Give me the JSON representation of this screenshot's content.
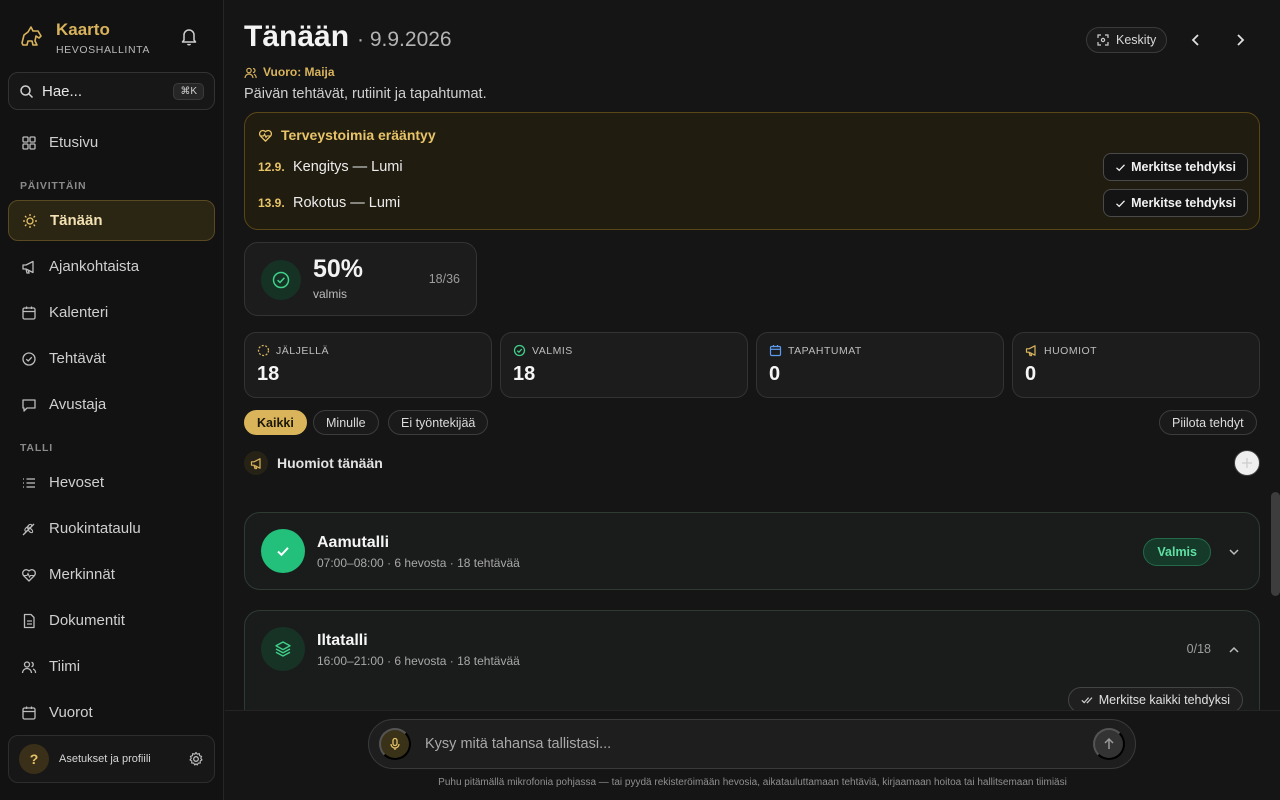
{
  "brand": {
    "name": "Kaarto",
    "subtitle": "HEVOSHALLINTA"
  },
  "search": {
    "placeholder": "Hae...",
    "shortcut": "⌘K"
  },
  "nav": {
    "top": [
      {
        "label": "Etusivu",
        "icon": "grid-icon"
      }
    ],
    "section_daily": "PÄIVITTÄIN",
    "daily": [
      {
        "label": "Tänään",
        "icon": "sun-icon",
        "active": true
      },
      {
        "label": "Ajankohtaista",
        "icon": "megaphone-icon"
      },
      {
        "label": "Kalenteri",
        "icon": "calendar-icon"
      },
      {
        "label": "Tehtävät",
        "icon": "check-circle-icon"
      },
      {
        "label": "Avustaja",
        "icon": "chat-icon"
      }
    ],
    "section_stable": "TALLI",
    "stable": [
      {
        "label": "Hevoset",
        "icon": "list-icon"
      },
      {
        "label": "Ruokintataulu",
        "icon": "wheat-icon"
      },
      {
        "label": "Merkinnät",
        "icon": "heart-pulse-icon"
      },
      {
        "label": "Dokumentit",
        "icon": "document-icon"
      },
      {
        "label": "Tiimi",
        "icon": "users-icon"
      },
      {
        "label": "Vuorot",
        "icon": "calendar-icon"
      }
    ]
  },
  "profile": {
    "avatar": "?",
    "label": "Asetukset ja profiili"
  },
  "header": {
    "title": "Tänään",
    "date": "· 9.9.2026",
    "shift": "Vuoro: Maija",
    "subtitle": "Päivän tehtävät, rutiinit ja tapahtumat.",
    "focus_label": "Keskity"
  },
  "health_alert": {
    "title": "Terveystoimia erääntyy",
    "items": [
      {
        "date": "12.9.",
        "text": "Kengitys — Lumi",
        "action": "Merkitse tehdyksi"
      },
      {
        "date": "13.9.",
        "text": "Rokotus — Lumi",
        "action": "Merkitse tehdyksi"
      }
    ]
  },
  "progress": {
    "percent_label": "50%",
    "label": "valmis",
    "count": "18/36",
    "fraction": 0.5
  },
  "stats": [
    {
      "label": "JÄLJELLÄ",
      "value": "18",
      "icon": "dashed-circle-icon",
      "color": "#d8b35c"
    },
    {
      "label": "VALMIS",
      "value": "18",
      "icon": "check-circle-icon",
      "color": "#3fd08a"
    },
    {
      "label": "TAPAHTUMAT",
      "value": "0",
      "icon": "calendar-icon",
      "color": "#5b9cf0"
    },
    {
      "label": "HUOMIOT",
      "value": "0",
      "icon": "megaphone-icon",
      "color": "#d8b35c"
    }
  ],
  "filters": {
    "all": "Kaikki",
    "mine": "Minulle",
    "unassigned": "Ei työntekijää",
    "hide_done": "Piilota tehdyt"
  },
  "notes": {
    "title": "Huomiot tänään"
  },
  "routines": [
    {
      "title": "Aamutalli",
      "meta": "07:00–08:00 · 6 hevosta · 18 tehtävää",
      "status": "Valmis"
    },
    {
      "title": "Iltatalli",
      "meta": "16:00–21:00 · 6 hevosta · 18 tehtävää",
      "count": "0/18",
      "action": "Merkitse kaikki tehdyksi"
    }
  ],
  "assistant": {
    "placeholder": "Kysy mitä tahansa tallistasi...",
    "hint": "Puhu pitämällä mikrofonia pohjassa — tai pyydä rekisteröimään hevosia, aikatauluttamaan tehtäviä, kirjaamaan hoitoa tai hallitsemaan tiimiäsi"
  },
  "colors": {
    "accent": "#d8b35c",
    "success": "#3fd08a",
    "background": "#151515"
  }
}
